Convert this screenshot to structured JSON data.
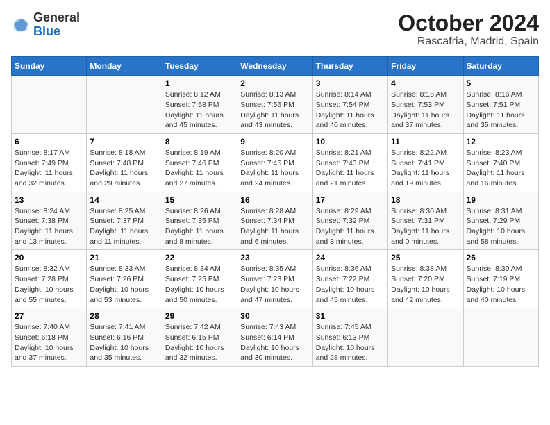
{
  "logo": {
    "general": "General",
    "blue": "Blue"
  },
  "title": "October 2024",
  "subtitle": "Rascafria, Madrid, Spain",
  "days_of_week": [
    "Sunday",
    "Monday",
    "Tuesday",
    "Wednesday",
    "Thursday",
    "Friday",
    "Saturday"
  ],
  "weeks": [
    [
      {
        "day": "",
        "info": ""
      },
      {
        "day": "",
        "info": ""
      },
      {
        "day": "1",
        "info": "Sunrise: 8:12 AM\nSunset: 7:58 PM\nDaylight: 11 hours and 45 minutes."
      },
      {
        "day": "2",
        "info": "Sunrise: 8:13 AM\nSunset: 7:56 PM\nDaylight: 11 hours and 43 minutes."
      },
      {
        "day": "3",
        "info": "Sunrise: 8:14 AM\nSunset: 7:54 PM\nDaylight: 11 hours and 40 minutes."
      },
      {
        "day": "4",
        "info": "Sunrise: 8:15 AM\nSunset: 7:53 PM\nDaylight: 11 hours and 37 minutes."
      },
      {
        "day": "5",
        "info": "Sunrise: 8:16 AM\nSunset: 7:51 PM\nDaylight: 11 hours and 35 minutes."
      }
    ],
    [
      {
        "day": "6",
        "info": "Sunrise: 8:17 AM\nSunset: 7:49 PM\nDaylight: 11 hours and 32 minutes."
      },
      {
        "day": "7",
        "info": "Sunrise: 8:18 AM\nSunset: 7:48 PM\nDaylight: 11 hours and 29 minutes."
      },
      {
        "day": "8",
        "info": "Sunrise: 8:19 AM\nSunset: 7:46 PM\nDaylight: 11 hours and 27 minutes."
      },
      {
        "day": "9",
        "info": "Sunrise: 8:20 AM\nSunset: 7:45 PM\nDaylight: 11 hours and 24 minutes."
      },
      {
        "day": "10",
        "info": "Sunrise: 8:21 AM\nSunset: 7:43 PM\nDaylight: 11 hours and 21 minutes."
      },
      {
        "day": "11",
        "info": "Sunrise: 8:22 AM\nSunset: 7:41 PM\nDaylight: 11 hours and 19 minutes."
      },
      {
        "day": "12",
        "info": "Sunrise: 8:23 AM\nSunset: 7:40 PM\nDaylight: 11 hours and 16 minutes."
      }
    ],
    [
      {
        "day": "13",
        "info": "Sunrise: 8:24 AM\nSunset: 7:38 PM\nDaylight: 11 hours and 13 minutes."
      },
      {
        "day": "14",
        "info": "Sunrise: 8:25 AM\nSunset: 7:37 PM\nDaylight: 11 hours and 11 minutes."
      },
      {
        "day": "15",
        "info": "Sunrise: 8:26 AM\nSunset: 7:35 PM\nDaylight: 11 hours and 8 minutes."
      },
      {
        "day": "16",
        "info": "Sunrise: 8:28 AM\nSunset: 7:34 PM\nDaylight: 11 hours and 6 minutes."
      },
      {
        "day": "17",
        "info": "Sunrise: 8:29 AM\nSunset: 7:32 PM\nDaylight: 11 hours and 3 minutes."
      },
      {
        "day": "18",
        "info": "Sunrise: 8:30 AM\nSunset: 7:31 PM\nDaylight: 11 hours and 0 minutes."
      },
      {
        "day": "19",
        "info": "Sunrise: 8:31 AM\nSunset: 7:29 PM\nDaylight: 10 hours and 58 minutes."
      }
    ],
    [
      {
        "day": "20",
        "info": "Sunrise: 8:32 AM\nSunset: 7:28 PM\nDaylight: 10 hours and 55 minutes."
      },
      {
        "day": "21",
        "info": "Sunrise: 8:33 AM\nSunset: 7:26 PM\nDaylight: 10 hours and 53 minutes."
      },
      {
        "day": "22",
        "info": "Sunrise: 8:34 AM\nSunset: 7:25 PM\nDaylight: 10 hours and 50 minutes."
      },
      {
        "day": "23",
        "info": "Sunrise: 8:35 AM\nSunset: 7:23 PM\nDaylight: 10 hours and 47 minutes."
      },
      {
        "day": "24",
        "info": "Sunrise: 8:36 AM\nSunset: 7:22 PM\nDaylight: 10 hours and 45 minutes."
      },
      {
        "day": "25",
        "info": "Sunrise: 8:38 AM\nSunset: 7:20 PM\nDaylight: 10 hours and 42 minutes."
      },
      {
        "day": "26",
        "info": "Sunrise: 8:39 AM\nSunset: 7:19 PM\nDaylight: 10 hours and 40 minutes."
      }
    ],
    [
      {
        "day": "27",
        "info": "Sunrise: 7:40 AM\nSunset: 6:18 PM\nDaylight: 10 hours and 37 minutes."
      },
      {
        "day": "28",
        "info": "Sunrise: 7:41 AM\nSunset: 6:16 PM\nDaylight: 10 hours and 35 minutes."
      },
      {
        "day": "29",
        "info": "Sunrise: 7:42 AM\nSunset: 6:15 PM\nDaylight: 10 hours and 32 minutes."
      },
      {
        "day": "30",
        "info": "Sunrise: 7:43 AM\nSunset: 6:14 PM\nDaylight: 10 hours and 30 minutes."
      },
      {
        "day": "31",
        "info": "Sunrise: 7:45 AM\nSunset: 6:13 PM\nDaylight: 10 hours and 28 minutes."
      },
      {
        "day": "",
        "info": ""
      },
      {
        "day": "",
        "info": ""
      }
    ]
  ]
}
